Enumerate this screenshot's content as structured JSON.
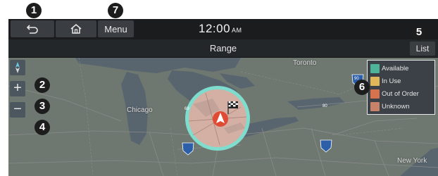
{
  "callouts": [
    "1",
    "2",
    "3",
    "4",
    "5",
    "6",
    "7"
  ],
  "topbar": {
    "back_icon": "back-arrow-icon",
    "home_icon": "home-icon",
    "menu_label": "Menu",
    "time": "12:00",
    "ampm": "AM"
  },
  "titlebar": {
    "title": "Range",
    "list_label": "List"
  },
  "map": {
    "labels": {
      "chicago": "Chicago",
      "toronto": "Toronto",
      "new_york": "New York"
    },
    "shields": [
      "69",
      "80",
      "90"
    ],
    "controls": {
      "zoom_in": "+",
      "zoom_out": "−",
      "compass_icon": "compass-icon"
    }
  },
  "legend": {
    "items": [
      {
        "label": "Available",
        "color": "#4fb39a"
      },
      {
        "label": "In Use",
        "color": "#e0b85a"
      },
      {
        "label": "Out of Order",
        "color": "#d4734e"
      },
      {
        "label": "Unknown",
        "color": "#c9826a"
      }
    ]
  },
  "colors": {
    "range_fill": "#cfa79b",
    "range_ring": "#7ee2d4",
    "vehicle_marker": "#e04b36",
    "water": "#5e6a74",
    "land": "#6f7a6f"
  }
}
